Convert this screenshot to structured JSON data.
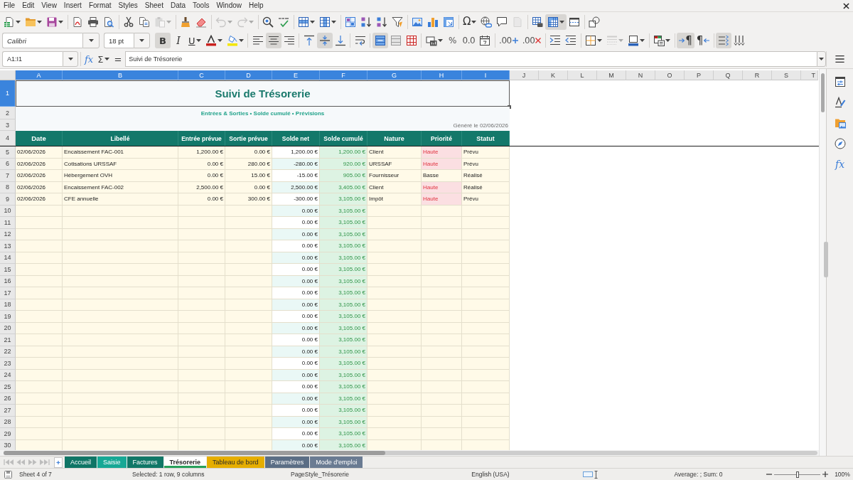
{
  "menu_bar": {
    "items": [
      "File",
      "Edit",
      "View",
      "Insert",
      "Format",
      "Styles",
      "Sheet",
      "Data",
      "Tools",
      "Window",
      "Help"
    ]
  },
  "standard_toolbar": {
    "paste": {
      "disabled": true
    },
    "undo": {
      "disabled": true
    },
    "redo": {
      "disabled": true
    },
    "special_character": {
      "label": "Ω"
    },
    "header_footer": {
      "disabled": true
    },
    "freeze": {
      "pressed": true
    }
  },
  "formatting_toolbar": {
    "font_name": "Calibri",
    "font_size": "18 pt",
    "bold": {
      "label": "B",
      "pressed": true
    },
    "italic": {
      "label": "I",
      "pressed": false
    },
    "underline": {
      "label": "U",
      "pressed": false
    },
    "align_left": {
      "pressed": false
    },
    "align_center": {
      "pressed": true
    },
    "align_right": {
      "pressed": false
    },
    "align_top": {
      "pressed": false
    },
    "align_middle": {
      "pressed": true
    },
    "align_bottom": {
      "pressed": false
    },
    "merge_center": {
      "pressed": true
    },
    "percent": {
      "label": "%"
    },
    "number": {
      "label": "0.0"
    },
    "add_decimal": {
      "label": ".00"
    },
    "delete_decimal": {
      "label": ".00"
    },
    "border_style": {
      "disabled": true
    },
    "paragraph_ltr": {
      "label": "¶",
      "pressed": true
    },
    "paragraph_rtl": {
      "label": "¶",
      "pressed": false
    },
    "text_horizontal": {
      "pressed": true
    },
    "text_vertical": {
      "pressed": false
    }
  },
  "formula_bar": {
    "name_box": "A1:I1",
    "function_wizard": "fx",
    "sum": "Σ",
    "equals": "=",
    "content": "Suivi de Trésorerie"
  },
  "sidebar": {
    "functions": "fx"
  },
  "sheet": {
    "columns": [
      {
        "label": "A",
        "selected": true
      },
      {
        "label": "B",
        "selected": true
      },
      {
        "label": "C",
        "selected": true
      },
      {
        "label": "D",
        "selected": true
      },
      {
        "label": "E",
        "selected": true
      },
      {
        "label": "F",
        "selected": true
      },
      {
        "label": "G",
        "selected": true
      },
      {
        "label": "H",
        "selected": true
      },
      {
        "label": "I",
        "selected": true
      },
      {
        "label": "J",
        "selected": false
      },
      {
        "label": "K",
        "selected": false
      },
      {
        "label": "L",
        "selected": false
      },
      {
        "label": "M",
        "selected": false
      },
      {
        "label": "N",
        "selected": false
      },
      {
        "label": "O",
        "selected": false
      },
      {
        "label": "P",
        "selected": false
      },
      {
        "label": "Q",
        "selected": false
      },
      {
        "label": "R",
        "selected": false
      },
      {
        "label": "S",
        "selected": false
      },
      {
        "label": "T",
        "selected": false
      }
    ],
    "rows": [
      {
        "label": "1",
        "selected": true,
        "kind": "title",
        "title": "Suivi de Trésorerie"
      },
      {
        "label": "2",
        "selected": false,
        "kind": "subtitle",
        "subtitle": "Entrées & Sorties • Solde cumulé • Prévisions"
      },
      {
        "label": "3",
        "selected": false,
        "kind": "note",
        "note": "Généré le 02/06/2026"
      },
      {
        "label": "4",
        "selected": false,
        "kind": "header",
        "cells": [
          "Date",
          "Libellé",
          "Entrée prévue",
          "Sortie prévue",
          "Solde net",
          "Solde cumulé",
          "Nature",
          "Priorité",
          "Statut"
        ]
      },
      {
        "label": "5",
        "selected": false,
        "kind": "entry",
        "priority_alert": true,
        "cells": {
          "date": "02/06/2026",
          "label": "Encaissement FAC-001",
          "planned_in": "1,200.00 €",
          "planned_out": "0.00 €",
          "net": "1,200.00 €",
          "cumulative": "1,200.00 €",
          "nature": "Client",
          "priority": "Haute",
          "status": "Prévu"
        }
      },
      {
        "label": "6",
        "selected": false,
        "kind": "entry",
        "priority_alert": true,
        "cells": {
          "date": "02/06/2026",
          "label": "Cotisations URSSAF",
          "planned_in": "0.00 €",
          "planned_out": "280.00 €",
          "net": "-280.00 €",
          "cumulative": "920.00 €",
          "nature": "URSSAF",
          "priority": "Haute",
          "status": "Prévu"
        }
      },
      {
        "label": "7",
        "selected": false,
        "kind": "entry",
        "priority_alert": false,
        "cells": {
          "date": "02/06/2026",
          "label": "Hébergement OVH",
          "planned_in": "0.00 €",
          "planned_out": "15.00 €",
          "net": "-15.00 €",
          "cumulative": "905.00 €",
          "nature": "Fournisseur",
          "priority": "Basse",
          "status": "Réalisé"
        }
      },
      {
        "label": "8",
        "selected": false,
        "kind": "entry",
        "priority_alert": true,
        "cells": {
          "date": "02/06/2026",
          "label": "Encaissement FAC-002",
          "planned_in": "2,500.00 €",
          "planned_out": "0.00 €",
          "net": "2,500.00 €",
          "cumulative": "3,405.00 €",
          "nature": "Client",
          "priority": "Haute",
          "status": "Réalisé"
        }
      },
      {
        "label": "9",
        "selected": false,
        "kind": "entry",
        "priority_alert": true,
        "cells": {
          "date": "02/06/2026",
          "label": "CFE annuelle",
          "planned_in": "0.00 €",
          "planned_out": "300.00 €",
          "net": "-300.00 €",
          "cumulative": "3,105.00 €",
          "nature": "Impôt",
          "priority": "Haute",
          "status": "Prévu"
        }
      },
      {
        "label": "10",
        "selected": false,
        "kind": "entry",
        "priority_alert": false,
        "cells": {
          "net": "0.00 €",
          "cumulative": "3,105.00 €"
        }
      },
      {
        "label": "11",
        "selected": false,
        "kind": "entry",
        "priority_alert": false,
        "cells": {
          "net": "0.00 €",
          "cumulative": "3,105.00 €"
        }
      },
      {
        "label": "12",
        "selected": false,
        "kind": "entry",
        "priority_alert": false,
        "cells": {
          "net": "0.00 €",
          "cumulative": "3,105.00 €"
        }
      },
      {
        "label": "13",
        "selected": false,
        "kind": "entry",
        "priority_alert": false,
        "cells": {
          "net": "0.00 €",
          "cumulative": "3,105.00 €"
        }
      },
      {
        "label": "14",
        "selected": false,
        "kind": "entry",
        "priority_alert": false,
        "cells": {
          "net": "0.00 €",
          "cumulative": "3,105.00 €"
        }
      },
      {
        "label": "15",
        "selected": false,
        "kind": "entry",
        "priority_alert": false,
        "cells": {
          "net": "0.00 €",
          "cumulative": "3,105.00 €"
        }
      },
      {
        "label": "16",
        "selected": false,
        "kind": "entry",
        "priority_alert": false,
        "cells": {
          "net": "0.00 €",
          "cumulative": "3,105.00 €"
        }
      },
      {
        "label": "17",
        "selected": false,
        "kind": "entry",
        "priority_alert": false,
        "cells": {
          "net": "0.00 €",
          "cumulative": "3,105.00 €"
        }
      },
      {
        "label": "18",
        "selected": false,
        "kind": "entry",
        "priority_alert": false,
        "cells": {
          "net": "0.00 €",
          "cumulative": "3,105.00 €"
        }
      },
      {
        "label": "19",
        "selected": false,
        "kind": "entry",
        "priority_alert": false,
        "cells": {
          "net": "0.00 €",
          "cumulative": "3,105.00 €"
        }
      },
      {
        "label": "20",
        "selected": false,
        "kind": "entry",
        "priority_alert": false,
        "cells": {
          "net": "0.00 €",
          "cumulative": "3,105.00 €"
        }
      },
      {
        "label": "21",
        "selected": false,
        "kind": "entry",
        "priority_alert": false,
        "cells": {
          "net": "0.00 €",
          "cumulative": "3,105.00 €"
        }
      },
      {
        "label": "22",
        "selected": false,
        "kind": "entry",
        "priority_alert": false,
        "cells": {
          "net": "0.00 €",
          "cumulative": "3,105.00 €"
        }
      },
      {
        "label": "23",
        "selected": false,
        "kind": "entry",
        "priority_alert": false,
        "cells": {
          "net": "0.00 €",
          "cumulative": "3,105.00 €"
        }
      },
      {
        "label": "24",
        "selected": false,
        "kind": "entry",
        "priority_alert": false,
        "cells": {
          "net": "0.00 €",
          "cumulative": "3,105.00 €"
        }
      },
      {
        "label": "25",
        "selected": false,
        "kind": "entry",
        "priority_alert": false,
        "cells": {
          "net": "0.00 €",
          "cumulative": "3,105.00 €"
        }
      },
      {
        "label": "26",
        "selected": false,
        "kind": "entry",
        "priority_alert": false,
        "cells": {
          "net": "0.00 €",
          "cumulative": "3,105.00 €"
        }
      },
      {
        "label": "27",
        "selected": false,
        "kind": "entry",
        "priority_alert": false,
        "cells": {
          "net": "0.00 €",
          "cumulative": "3,105.00 €"
        }
      },
      {
        "label": "28",
        "selected": false,
        "kind": "entry",
        "priority_alert": false,
        "cells": {
          "net": "0.00 €",
          "cumulative": "3,105.00 €"
        }
      },
      {
        "label": "29",
        "selected": false,
        "kind": "entry",
        "priority_alert": false,
        "cells": {
          "net": "0.00 €",
          "cumulative": "3,105.00 €"
        }
      },
      {
        "label": "30",
        "selected": false,
        "kind": "entry",
        "priority_alert": false,
        "cells": {
          "net": "0.00 €",
          "cumulative": "3,105.00 €"
        }
      }
    ]
  },
  "sheet_tabs": [
    {
      "label": "Accueil",
      "color": "#0f7566",
      "selected": false
    },
    {
      "label": "Saisie",
      "color": "#17a895",
      "selected": false
    },
    {
      "label": "Factures",
      "color": "#107767",
      "selected": false
    },
    {
      "label": "Trésorerie",
      "color": "#27a05a",
      "selected": true
    },
    {
      "label": "Tableau de bord",
      "color": "#e6ae00",
      "selected": false
    },
    {
      "label": "Paramètres",
      "color": "#5b6e85",
      "selected": false
    },
    {
      "label": "Mode d'emploi",
      "color": "#6a7b92",
      "selected": false
    }
  ],
  "status_bar": {
    "sheet": "Sheet 4 of 7",
    "selection": "Selected: 1 row, 9 columns",
    "page_style": "PageStyle_Trésorerie",
    "language": "English (USA)",
    "summary": "Average: ; Sum: 0",
    "zoom": {
      "level": 0.5,
      "label": "100%"
    }
  }
}
